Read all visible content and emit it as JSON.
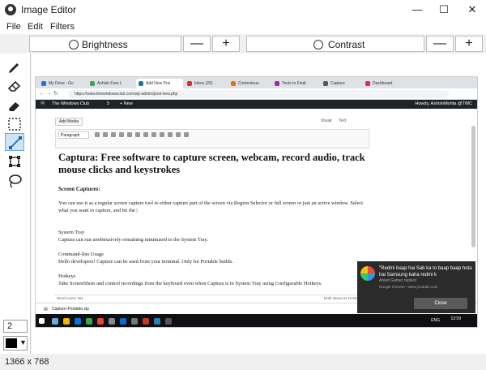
{
  "window": {
    "title": "Image Editor",
    "controls": {
      "minimize": "—",
      "maximize": "☐",
      "close": "✕"
    }
  },
  "menu": [
    "File",
    "Edit",
    "Filters"
  ],
  "toolbar": {
    "brightness_label": "Brightness",
    "contrast_label": "Contrast",
    "minus": "—",
    "plus": "+"
  },
  "tools": [
    "pencil-icon",
    "eraser-icon",
    "highlighter-icon",
    "select-rect-icon",
    "line-icon",
    "shape-icon",
    "lasso-icon"
  ],
  "brush_size": "2",
  "brush_color": "#000000",
  "status": {
    "dimensions": "1366 x 768"
  },
  "screenshot": {
    "tabs": [
      {
        "label": "My Drive - Go",
        "color": "#1a73e8"
      },
      {
        "label": "Ashish Free L",
        "color": "#34a853"
      },
      {
        "label": "Add New Pos",
        "color": "#21759b"
      },
      {
        "label": "Inbox (26) ·",
        "color": "#d93025"
      },
      {
        "label": "Contentous",
        "color": "#e37400"
      },
      {
        "label": "Tools to Findi",
        "color": "#9c27b0"
      },
      {
        "label": "Capture",
        "color": "#555555"
      },
      {
        "label": "Dashboard",
        "color": "#e91e63"
      }
    ],
    "url": "https://www.thewindowsclub.com/wp-admin/post-new.php",
    "wp": {
      "site": "The Windows Club",
      "count": "5",
      "new": "+ New",
      "howdy": "Howdy, AshishMohta @TWC"
    },
    "editor": {
      "add_media": "Add Media",
      "visual": "Visual",
      "text": "Text",
      "format": "Paragraph",
      "title": "Captura: Free software to capture screen, webcam, record audio, track mouse clicks and keystrokes",
      "section": "Screen Captures:",
      "p1": "You can use it as a regular screen capture tool to either capture part of the screen via Region Selector or full screen or just an active window. Select what you want to capture, and hit the |",
      "h_tray": "System Tray",
      "p_tray": "Captura can run unobtrusively remaining minimized to the System Tray.",
      "h_cli": "Command-line Usage",
      "p_cli": "Hello developers! Capture can be used from your terminal. Only for Portable builds.",
      "h_hot": "Hotkeys",
      "p_hot": "Take ScreenShots and control recordings from the keyboard even when Captura is in System Tray using Configurable Hotkeys.",
      "word_count": "Word count: 251",
      "draft": "Draft saved at 12:56:45 pm"
    },
    "download": "Capture-Portable.zip",
    "clock": {
      "time": "12:59",
      "lang": "ENG"
    },
    "toast": {
      "line1": "\"Redmi baap hai Sab ka to baap baap hota hai Samsung kaha redmi k",
      "line2": "Anket Gamer replied",
      "line3": "Google Chrome • www.youtube.com",
      "close": "Close"
    }
  }
}
